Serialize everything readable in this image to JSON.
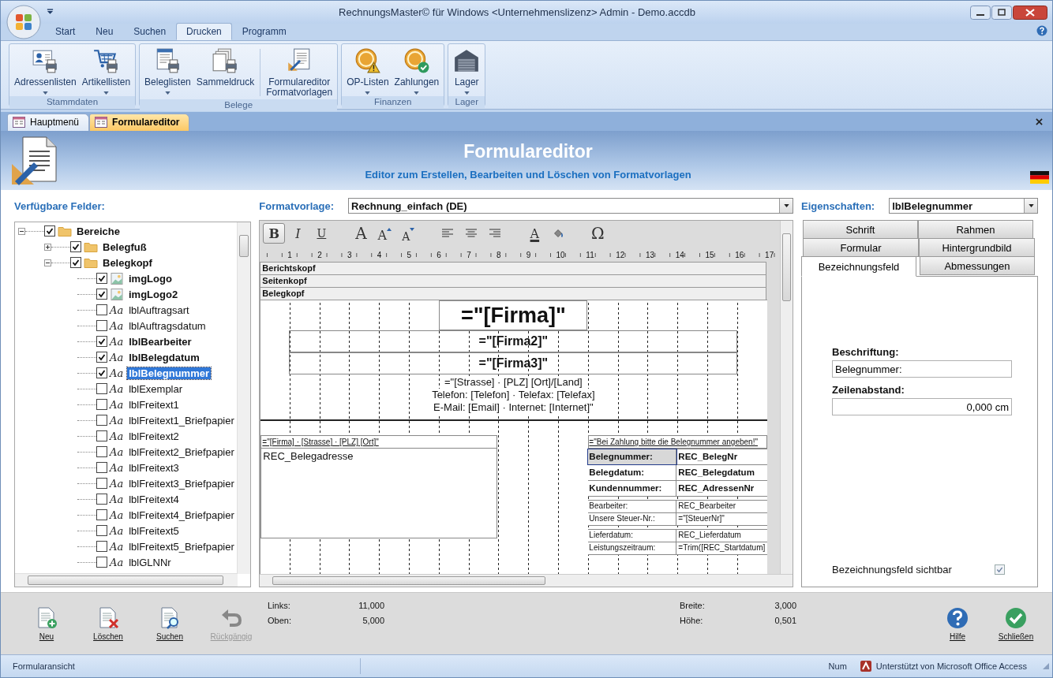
{
  "window": {
    "title": "RechnungsMaster© für Windows <Unternehmenslizenz> Admin - Demo.accdb"
  },
  "ribbon_tabs": [
    {
      "label": "Start",
      "selected": false
    },
    {
      "label": "Neu",
      "selected": false
    },
    {
      "label": "Suchen",
      "selected": false
    },
    {
      "label": "Drucken",
      "selected": true
    },
    {
      "label": "Programm",
      "selected": false
    }
  ],
  "ribbon_groups": [
    {
      "label": "Stammdaten",
      "buttons": [
        {
          "label": "Adressenlisten",
          "kind": "address-list",
          "dropdown": true
        },
        {
          "label": "Artikellisten",
          "kind": "article-list",
          "dropdown": true
        }
      ]
    },
    {
      "label": "Belege",
      "buttons": [
        {
          "label": "Beleglisten",
          "kind": "document-list",
          "dropdown": true
        },
        {
          "label": "Sammeldruck",
          "kind": "batch-print",
          "dropdown": false
        },
        {
          "label": "Formulareditor\nFormatvorlagen",
          "kind": "form-editor",
          "dropdown": false
        }
      ]
    },
    {
      "label": "Finanzen",
      "buttons": [
        {
          "label": "OP-Listen",
          "kind": "open-items",
          "dropdown": true
        },
        {
          "label": "Zahlungen",
          "kind": "payments",
          "dropdown": true
        }
      ]
    },
    {
      "label": "Lager",
      "buttons": [
        {
          "label": "Lager",
          "kind": "warehouse",
          "dropdown": true
        }
      ]
    }
  ],
  "doc_tabs": [
    {
      "label": "Hauptmenü",
      "selected": false
    },
    {
      "label": "Formulareditor",
      "selected": true
    }
  ],
  "header": {
    "title": "Formulareditor",
    "subtitle": "Editor zum Erstellen, Bearbeiten und Löschen von Formatvorlagen"
  },
  "fields_panel": {
    "label": "Verfügbare Felder:",
    "tree": [
      {
        "label": "Bereiche",
        "kind": "folder",
        "checked": true,
        "expanded": true,
        "selected": false,
        "children": [
          {
            "label": "Belegfuß",
            "kind": "folder",
            "checked": true,
            "expanded": false,
            "selected": false
          },
          {
            "label": "Belegkopf",
            "kind": "folder",
            "checked": true,
            "expanded": true,
            "selected": false,
            "children": [
              {
                "label": "imgLogo",
                "kind": "image",
                "checked": true,
                "selected": false
              },
              {
                "label": "imgLogo2",
                "kind": "image",
                "checked": true,
                "selected": false
              },
              {
                "label": "lblAuftragsart",
                "kind": "label",
                "glyph": "Aa",
                "checked": false,
                "selected": false
              },
              {
                "label": "lblAuftragsdatum",
                "kind": "label",
                "glyph": "Aa",
                "checked": false,
                "selected": false
              },
              {
                "label": "lblBearbeiter",
                "kind": "label",
                "glyph": "Aa",
                "checked": true,
                "selected": false
              },
              {
                "label": "lblBelegdatum",
                "kind": "label",
                "glyph": "Aa",
                "checked": true,
                "selected": false
              },
              {
                "label": "lblBelegnummer",
                "kind": "label",
                "glyph": "Aa",
                "checked": true,
                "selected": true
              },
              {
                "label": "lblExemplar",
                "kind": "label",
                "glyph": "Aa",
                "checked": false,
                "selected": false
              },
              {
                "label": "lblFreitext1",
                "kind": "label",
                "glyph": "Aa",
                "checked": false,
                "selected": false
              },
              {
                "label": "lblFreitext1_Briefpapier",
                "kind": "label",
                "glyph": "Aa",
                "checked": false,
                "selected": false
              },
              {
                "label": "lblFreitext2",
                "kind": "label",
                "glyph": "Aa",
                "checked": false,
                "selected": false
              },
              {
                "label": "lblFreitext2_Briefpapier",
                "kind": "label",
                "glyph": "Aa",
                "checked": false,
                "selected": false
              },
              {
                "label": "lblFreitext3",
                "kind": "label",
                "glyph": "Aa",
                "checked": false,
                "selected": false
              },
              {
                "label": "lblFreitext3_Briefpapier",
                "kind": "label",
                "glyph": "Aa",
                "checked": false,
                "selected": false
              },
              {
                "label": "lblFreitext4",
                "kind": "label",
                "glyph": "Aa",
                "checked": false,
                "selected": false
              },
              {
                "label": "lblFreitext4_Briefpapier",
                "kind": "label",
                "glyph": "Aa",
                "checked": false,
                "selected": false
              },
              {
                "label": "lblFreitext5",
                "kind": "label",
                "glyph": "Aa",
                "checked": false,
                "selected": false
              },
              {
                "label": "lblFreitext5_Briefpapier",
                "kind": "label",
                "glyph": "Aa",
                "checked": false,
                "selected": false
              },
              {
                "label": "lblGLNNr",
                "kind": "label",
                "glyph": "Aa",
                "checked": false,
                "selected": false
              }
            ]
          }
        ]
      }
    ]
  },
  "template": {
    "label": "Formatvorlage:",
    "value": "Rechnung_einfach (DE)"
  },
  "toolbar": [
    {
      "kind": "bold",
      "glyph": "B",
      "selected": true
    },
    {
      "kind": "italic",
      "glyph": "I",
      "selected": false
    },
    {
      "kind": "underline",
      "glyph": "U",
      "selected": false
    },
    {
      "kind": "font-size",
      "glyph": "A",
      "selected": false
    },
    {
      "kind": "grow-font",
      "glyph": "A",
      "selected": false
    },
    {
      "kind": "shrink-font",
      "glyph": "A",
      "selected": false
    },
    {
      "kind": "align-left",
      "selected": false
    },
    {
      "kind": "align-center",
      "selected": false
    },
    {
      "kind": "align-right",
      "selected": false
    },
    {
      "kind": "font-color",
      "glyph": "A",
      "selected": false
    },
    {
      "kind": "fill-color",
      "selected": false
    },
    {
      "kind": "symbol",
      "glyph": "Ω",
      "selected": false
    }
  ],
  "ruler": [
    "1",
    "2",
    "3",
    "4",
    "5",
    "6",
    "7",
    "8",
    "9",
    "10",
    "11",
    "12",
    "13",
    "14",
    "15",
    "16",
    "17"
  ],
  "sections": [
    "Berichtskopf",
    "Seitenkopf",
    "Belegkopf"
  ],
  "canvas": {
    "company_lines": [
      {
        "kind": "title",
        "text": "=\"[Firma]\""
      },
      {
        "kind": "subtitle",
        "text": "=\"[Firma2]\""
      },
      {
        "kind": "subtitle",
        "text": "=\"[Firma3]\""
      }
    ],
    "contact_lines": [
      "=\"[Strasse] · [PLZ] [Ort]/[Land]",
      "Telefon: [Telefon] · Telefax: [Telefax]",
      "E-Mail: [Email] · Internet: [Internet]\""
    ],
    "sender_line": "=\"[Firma] · [Strasse] · [PLZ] [Ort]\"",
    "address_field": "REC_Belegadresse",
    "payment_note": "=\"Bei Zahlung bitte die Belegnummer angeben!\"",
    "info_groups": [
      {
        "kind": "main",
        "rows": [
          {
            "label": "Belegnummer:",
            "value": "REC_BelegNr",
            "selected": true
          },
          {
            "label": "Belegdatum:",
            "value": "REC_Belegdatum",
            "selected": false
          },
          {
            "label": "Kundennummer:",
            "value": "REC_AdressenNr",
            "selected": false
          }
        ]
      },
      {
        "kind": "detail",
        "rows": [
          {
            "label": "Bearbeiter:",
            "value": "REC_Bearbeiter",
            "selected": false
          },
          {
            "label": "Unsere Steuer-Nr.:",
            "value": "=\"[SteuerNr]\"",
            "selected": false
          }
        ]
      },
      {
        "kind": "detail",
        "rows": [
          {
            "label": "Lieferdatum:",
            "value": "REC_Lieferdatum",
            "selected": false
          },
          {
            "label": "Leistungszeitraum:",
            "value": "=Trim([REC_Startdatum]",
            "selected": false
          }
        ]
      }
    ]
  },
  "properties": {
    "label": "Eigenschaften:",
    "value": "lblBelegnummer",
    "tab_rows": [
      [
        {
          "label": "Schrift",
          "selected": false
        },
        {
          "label": "Rahmen",
          "selected": false
        }
      ],
      [
        {
          "label": "Formular",
          "selected": false
        },
        {
          "label": "Hintergrundbild",
          "selected": false
        }
      ],
      [
        {
          "label": "Bezeichnungsfeld",
          "selected": true
        },
        {
          "label": "Abmessungen",
          "selected": false
        }
      ]
    ],
    "fields": [
      {
        "label": "Beschriftung:",
        "value": "Belegnummer:"
      },
      {
        "label": "Zeilenabstand:",
        "value": "0,000 cm"
      }
    ],
    "visible": {
      "label": "Bezeichnungsfeld sichtbar",
      "checked": true
    }
  },
  "bottom_toolbar": {
    "buttons": [
      {
        "label": "Neu",
        "kind": "new",
        "disabled": false
      },
      {
        "label": "Löschen",
        "kind": "delete",
        "disabled": false
      },
      {
        "label": "Suchen",
        "kind": "search",
        "disabled": false
      },
      {
        "label": "Rückgängig",
        "kind": "undo",
        "disabled": true
      }
    ],
    "metrics_left": [
      {
        "label": "Links:",
        "value": "11,000"
      },
      {
        "label": "Oben:",
        "value": "5,000"
      }
    ],
    "metrics_right": [
      {
        "label": "Breite:",
        "value": "3,000"
      },
      {
        "label": "Höhe:",
        "value": "0,501"
      }
    ],
    "right_buttons": [
      {
        "label": "Hilfe",
        "kind": "help",
        "disabled": false
      },
      {
        "label": "Schließen",
        "kind": "close",
        "disabled": false
      }
    ]
  },
  "status_bar": {
    "view": "Formularansicht",
    "mode": "Num",
    "info": "Unterstützt von Microsoft Office Access"
  }
}
